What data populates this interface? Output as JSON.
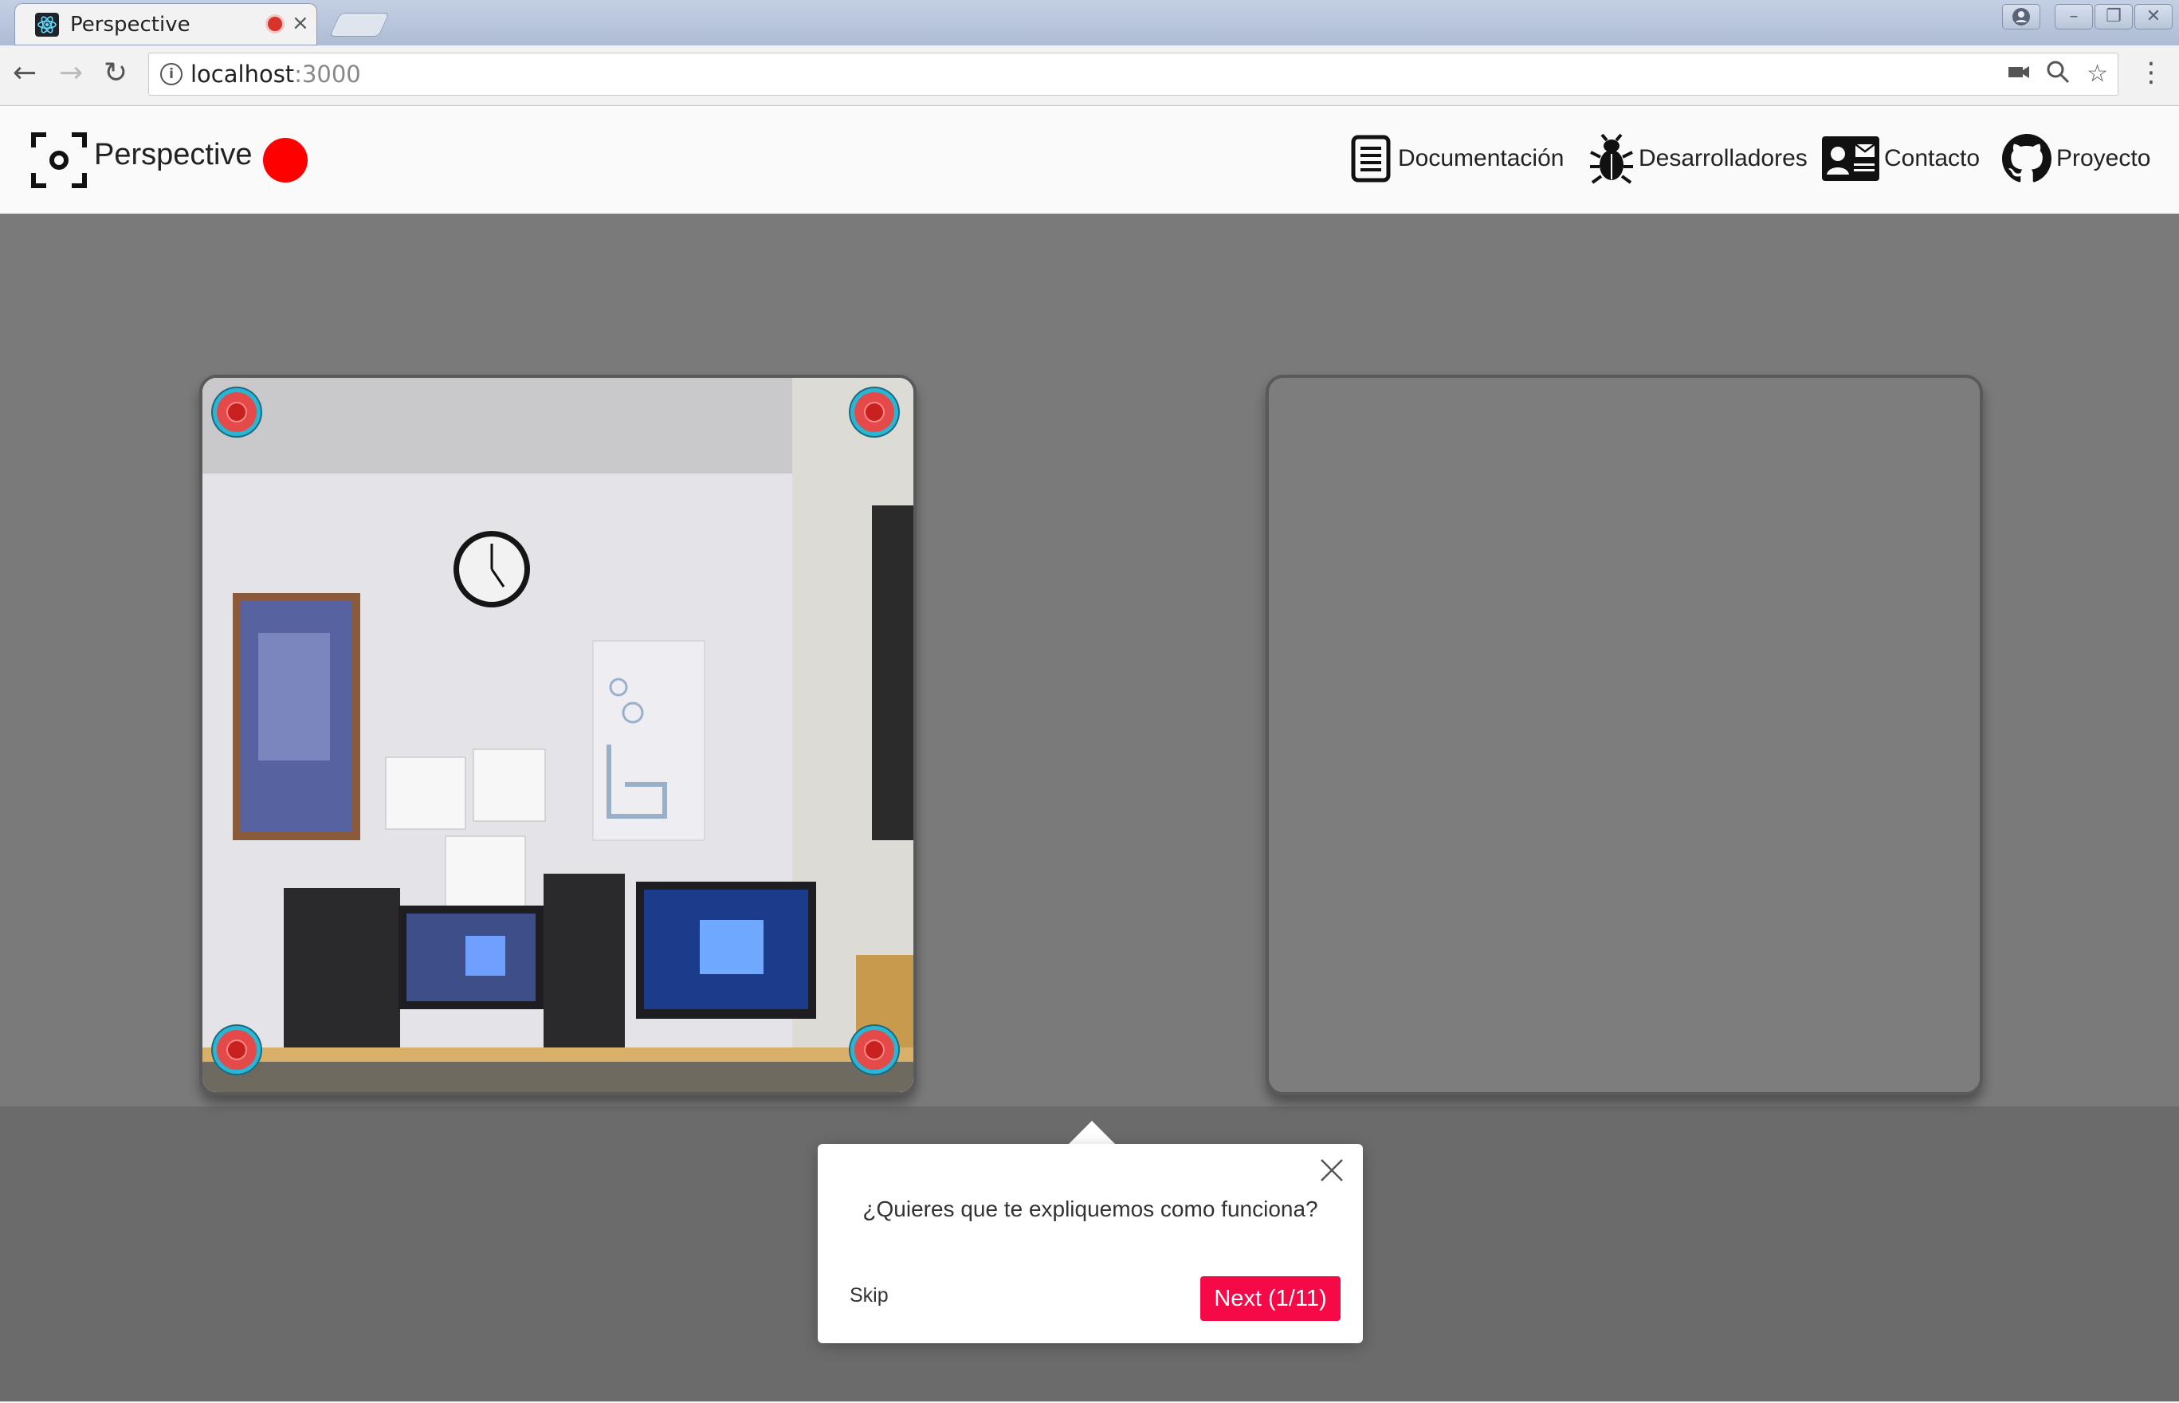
{
  "browser": {
    "tab_title": "Perspective",
    "tab_close": "×",
    "url_host": "localhost",
    "url_port": ":3000",
    "window_buttons": [
      "account",
      "minimize",
      "restore",
      "close"
    ]
  },
  "app": {
    "title": "Perspective",
    "recording_color": "#ff0000",
    "nav": [
      {
        "label": "Documentación",
        "icon": "document-icon"
      },
      {
        "label": "Desarrolladores",
        "icon": "bug-icon"
      },
      {
        "label": "Contacto",
        "icon": "contact-card-icon"
      },
      {
        "label": "Proyecto",
        "icon": "github-icon"
      }
    ]
  },
  "tour": {
    "question": "¿Quieres que te expliquemos como funciona?",
    "skip_label": "Skip",
    "next_label": "Next (1/11)",
    "accent_color": "#f50a47"
  }
}
